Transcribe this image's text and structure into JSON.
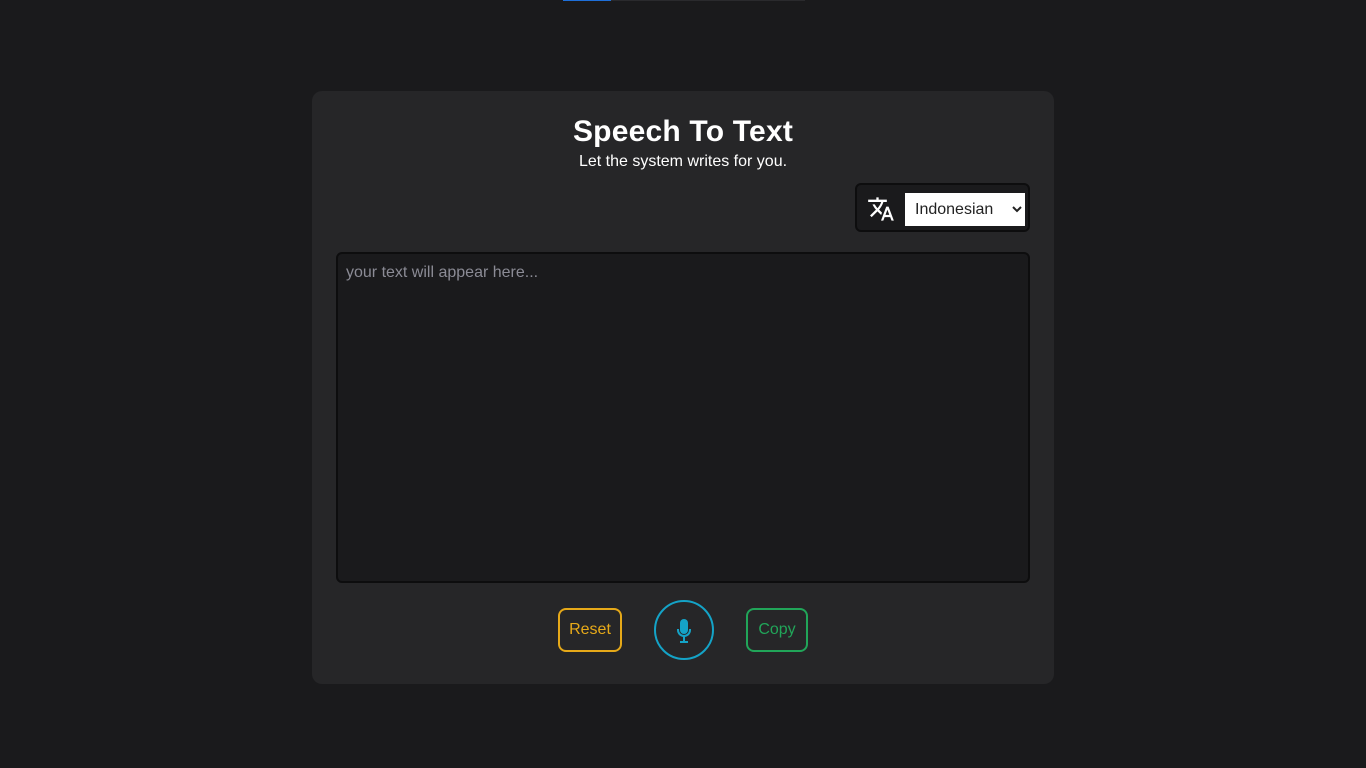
{
  "header": {
    "title": "Speech To Text",
    "subtitle": "Let the system writes for you."
  },
  "language": {
    "icon": "translate-icon",
    "selected": "Indonesian",
    "options": [
      "Indonesian"
    ]
  },
  "transcript": {
    "value": "",
    "placeholder": "your text will appear here..."
  },
  "actions": {
    "reset_label": "Reset",
    "mic_icon": "microphone-icon",
    "copy_label": "Copy"
  },
  "progress": {
    "fraction": 0.2
  },
  "colors": {
    "background": "#1a1a1c",
    "card": "#262628",
    "reset": "#e6a919",
    "mic": "#14a3c7",
    "copy": "#21a559",
    "progress": "#1e6fd9"
  }
}
